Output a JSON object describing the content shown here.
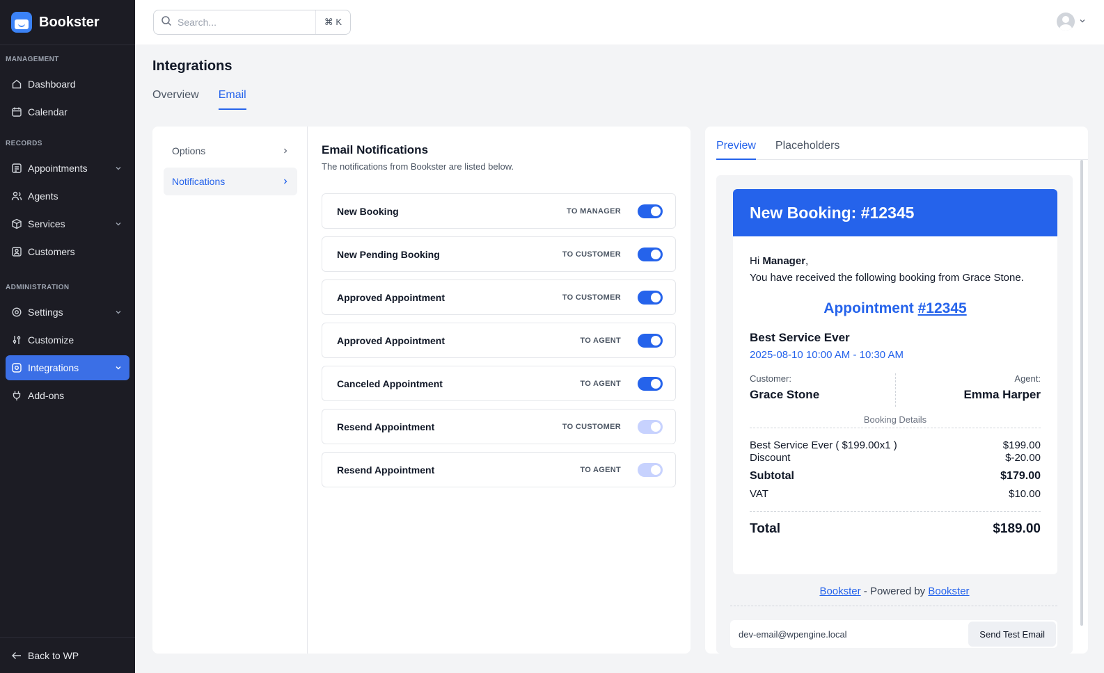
{
  "app": {
    "name": "Bookster"
  },
  "sidebar": {
    "sections": [
      {
        "label": "MANAGEMENT"
      },
      {
        "label": "RECORDS"
      },
      {
        "label": "ADMINISTRATION"
      }
    ],
    "items": [
      {
        "label": "Dashboard",
        "icon": "home-icon"
      },
      {
        "label": "Calendar",
        "icon": "calendar-icon"
      },
      {
        "label": "Appointments",
        "icon": "appointments-icon",
        "has_chevron": true
      },
      {
        "label": "Agents",
        "icon": "users-icon"
      },
      {
        "label": "Services",
        "icon": "box-icon",
        "has_chevron": true
      },
      {
        "label": "Customers",
        "icon": "customer-icon"
      },
      {
        "label": "Settings",
        "icon": "gear-icon",
        "has_chevron": true
      },
      {
        "label": "Customize",
        "icon": "sliders-icon"
      },
      {
        "label": "Integrations",
        "icon": "integrations-icon",
        "has_chevron": true,
        "active": true
      },
      {
        "label": "Add-ons",
        "icon": "plug-icon"
      }
    ],
    "back_label": "Back to WP"
  },
  "topbar": {
    "search_placeholder": "Search...",
    "shortcut": "⌘ K"
  },
  "page": {
    "title": "Integrations",
    "tabs": [
      {
        "label": "Overview",
        "active": false
      },
      {
        "label": "Email",
        "active": true
      }
    ]
  },
  "options": [
    {
      "label": "Options",
      "active": false
    },
    {
      "label": "Notifications",
      "active": true
    }
  ],
  "notifications": {
    "title": "Email Notifications",
    "subtitle": "The notifications from Bookster are listed below.",
    "items": [
      {
        "name": "New Booking",
        "target": "TO MANAGER",
        "enabled": true
      },
      {
        "name": "New Pending Booking",
        "target": "TO CUSTOMER",
        "enabled": true
      },
      {
        "name": "Approved Appointment",
        "target": "TO CUSTOMER",
        "enabled": true
      },
      {
        "name": "Approved Appointment",
        "target": "TO AGENT",
        "enabled": true
      },
      {
        "name": "Canceled Appointment",
        "target": "TO AGENT",
        "enabled": true
      },
      {
        "name": "Resend Appointment",
        "target": "TO CUSTOMER",
        "enabled": false
      },
      {
        "name": "Resend Appointment",
        "target": "TO AGENT",
        "enabled": false
      }
    ]
  },
  "preview": {
    "tabs": [
      {
        "label": "Preview",
        "active": true
      },
      {
        "label": "Placeholders",
        "active": false
      }
    ],
    "email": {
      "header": "New Booking: #12345",
      "greeting_hi": "Hi ",
      "greeting_name": "Manager",
      "greeting_comma": ",",
      "message": "You have received the following booking from Grace Stone.",
      "appt_label": "Appointment ",
      "appt_number": "#12345",
      "service_name": "Best Service Ever",
      "service_time": "2025-08-10 10:00 AM - 10:30 AM",
      "customer_label": "Customer:",
      "customer_name": "Grace Stone",
      "agent_label": "Agent:",
      "agent_name": "Emma Harper",
      "details_label": "Booking Details",
      "lines": [
        {
          "label": "Best Service Ever ( $199.00x1 )",
          "value": "$199.00"
        },
        {
          "label": "Discount",
          "value": "$-20.00"
        }
      ],
      "subtotal_label": "Subtotal",
      "subtotal_value": "$179.00",
      "vat_label": "VAT",
      "vat_value": "$10.00",
      "total_label": "Total",
      "total_value": "$189.00"
    },
    "footer": {
      "link1": "Bookster",
      "middle": " - Powered by ",
      "link2": "Bookster"
    },
    "test_email": "dev-email@wpengine.local",
    "send_label": "Send Test Email"
  },
  "colors": {
    "accent": "#2563eb",
    "sidebar_bg": "#1c1c24",
    "active_nav": "#3b6fe6"
  }
}
